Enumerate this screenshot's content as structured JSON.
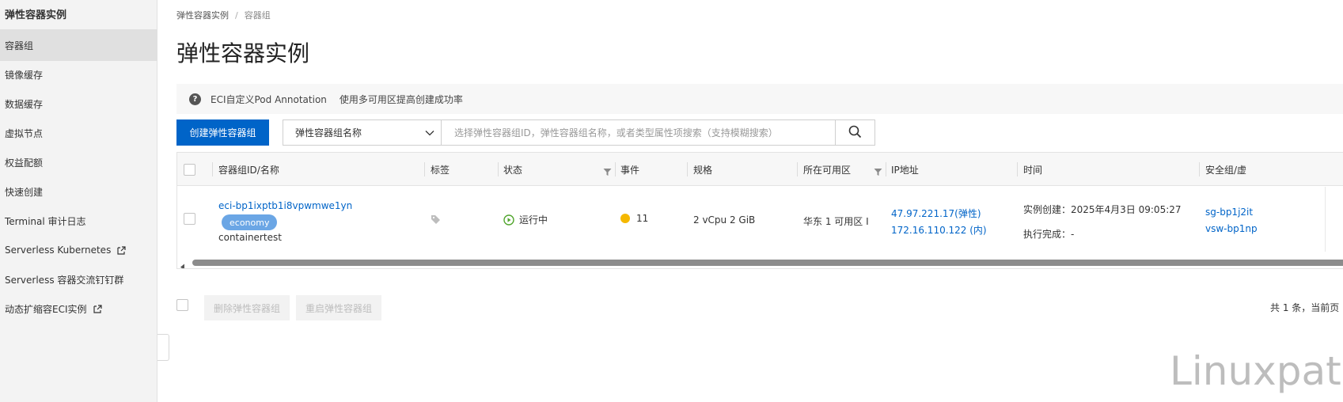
{
  "sidebar": {
    "title": "弹性容器实例",
    "items": [
      {
        "label": "容器组",
        "active": true
      },
      {
        "label": "镜像缓存"
      },
      {
        "label": "数据缓存"
      },
      {
        "label": "虚拟节点"
      },
      {
        "label": "权益配额"
      },
      {
        "label": "快速创建"
      },
      {
        "label": "Terminal 审计日志"
      },
      {
        "label": "Serverless Kubernetes",
        "external": true
      },
      {
        "label": "Serverless 容器交流钉钉群"
      },
      {
        "label": "动态扩缩容ECI实例",
        "external": true
      }
    ]
  },
  "breadcrumb": {
    "root": "弹性容器实例",
    "separator": "/",
    "current": "容器组"
  },
  "page": {
    "title": "弹性容器实例"
  },
  "notice": {
    "link1": "ECI自定义Pod Annotation",
    "link2": "使用多可用区提高创建成功率"
  },
  "toolbar": {
    "create_label": "创建弹性容器组",
    "select_value": "弹性容器组名称",
    "search_placeholder": "选择弹性容器组ID，弹性容器组名称，或者类型属性项搜索（支持模糊搜索）"
  },
  "table": {
    "columns": {
      "id_name": "容器组ID/名称",
      "tags": "标签",
      "status": "状态",
      "events": "事件",
      "spec": "规格",
      "zone": "所在可用区",
      "ip": "IP地址",
      "time": "时间",
      "security": "安全组/虚"
    },
    "rows": [
      {
        "id": "eci-bp1ixptb1i8vpwmwe1yn",
        "badge": "economy",
        "name": "containertest",
        "status": "运行中",
        "events": "11",
        "spec": "2 vCpu 2 GiB",
        "zone": "华东 1 可用区 I",
        "ip_public": "47.97.221.17(弹性)",
        "ip_private": "172.16.110.122 (内)",
        "time_created": "实例创建：2025年4月3日 09:05:27",
        "time_completed": "执行完成：-",
        "security_group": "sg-bp1j2it",
        "vswitch": "vsw-bp1np"
      }
    ]
  },
  "footer": {
    "delete_label": "删除弹性容器组",
    "restart_label": "重启弹性容器组",
    "pagination": "共 1 条，当前页"
  },
  "watermark": "Linuxpath",
  "colors": {
    "primary": "#0064c8",
    "badge": "#6ba6e5",
    "status_running": "#52a62e",
    "event_warning": "#f5b800"
  }
}
